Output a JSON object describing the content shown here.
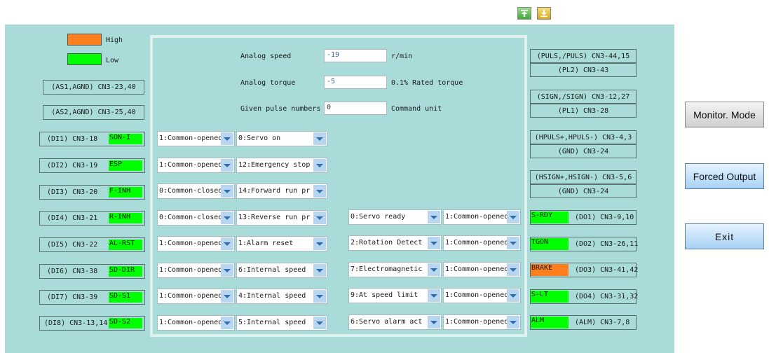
{
  "colors": {
    "high": "#ff7f1f",
    "low": "#00ff00",
    "panel": "#a9dbd8"
  },
  "toolbar": {
    "upload_icon": "upload-icon",
    "download_icon": "download-icon"
  },
  "legend": {
    "high": "High",
    "low": "Low"
  },
  "analog_inputs": [
    "(AS1,AGND) CN3-23,40",
    "(AS2,AGND) CN3-25,40"
  ],
  "digital_inputs": [
    {
      "label": "(DI1) CN3-18",
      "signal": "SON-I",
      "logic": "1:Common-opened",
      "function": "0:Servo on"
    },
    {
      "label": "(DI2) CN3-19",
      "signal": "ESP",
      "logic": "1:Common-opened",
      "function": "12:Emergency stop"
    },
    {
      "label": "(DI3) CN3-20",
      "signal": "F-INH",
      "logic": "0:Common-closed",
      "function": "14:Forward run pr"
    },
    {
      "label": "(DI4) CN3-21",
      "signal": "R-INH",
      "logic": "0:Common-closed",
      "function": "13:Reverse run pr"
    },
    {
      "label": "(DI5) CN3-22",
      "signal": "AL-RST",
      "logic": "1:Common-opened",
      "function": "1:Alarm reset"
    },
    {
      "label": "(DI6) CN3-38",
      "signal": "SD-DIR",
      "logic": "1:Common-opened",
      "function": "6:Internal speed"
    },
    {
      "label": "(DI7) CN3-39",
      "signal": "SD-S1",
      "logic": "1:Common-opened",
      "function": "4:Internal speed"
    },
    {
      "label": "(DI8) CN3-13,14",
      "signal": "SD-S2",
      "logic": "1:Common-opened",
      "function": "5:Internal speed"
    }
  ],
  "monitor": {
    "speed_label": "Analog speed",
    "speed_value": "-19",
    "speed_unit": "r/min",
    "torque_label": "Analog torque",
    "torque_value": "-5",
    "torque_unit": "0.1% Rated torque",
    "pulse_label": "Given pulse numbers",
    "pulse_value": "0",
    "pulse_unit": "Command unit"
  },
  "digital_outputs": [
    {
      "function": "0:Servo ready",
      "logic": "1:Common-opened",
      "signal": "S-RDY",
      "label": "(DO1) CN3-9,10",
      "state": "low"
    },
    {
      "function": "2:Rotation Detect",
      "logic": "1:Common-opened",
      "signal": "TGON",
      "label": "(DO2) CN3-26,11",
      "state": "low"
    },
    {
      "function": "7:Electromagnetic",
      "logic": "1:Common-opened",
      "signal": "BRAKE",
      "label": "(DO3) CN3-41,42",
      "state": "high"
    },
    {
      "function": "9:At speed limit",
      "logic": "1:Common-opened",
      "signal": "S-LT",
      "label": "(DO4) CN3-31,32",
      "state": "low"
    },
    {
      "function": "6:Servo alarm act",
      "logic": "1:Common-opened",
      "signal": "ALM",
      "label": "(ALM) CN3-7,8",
      "state": "low"
    }
  ],
  "pulse_ports": [
    [
      "(PULS,/PULS) CN3-44,15",
      "(PL2) CN3-43"
    ],
    [
      "(SIGN,/SIGN) CN3-12,27",
      "(PL1) CN3-28"
    ],
    [
      "(HPULS+,HPULS-) CN3-4,3",
      "(GND) CN3-24"
    ],
    [
      "(HSIGN+,HSIGN-) CN3-5,6",
      "(GND) CN3-24"
    ]
  ],
  "buttons": {
    "monitor": "Monitor. Mode",
    "forced": "Forced Output",
    "exit": "Exit"
  }
}
